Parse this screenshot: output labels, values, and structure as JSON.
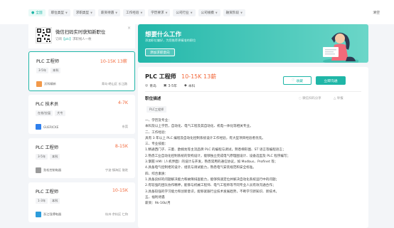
{
  "filters": {
    "chips": [
      {
        "label": "全国",
        "active": true
      },
      {
        "label": "职位类型",
        "active": false
      },
      {
        "label": "求职类型",
        "active": false
      },
      {
        "label": "薪资待遇",
        "active": false
      },
      {
        "label": "工作经验",
        "active": false
      },
      {
        "label": "学历要求",
        "active": false
      },
      {
        "label": "公司行业",
        "active": false
      },
      {
        "label": "公司规模",
        "active": false
      },
      {
        "label": "融资阶段",
        "active": false
      }
    ],
    "clear_label": "清空"
  },
  "qr_promo": {
    "title": "微信扫码实时获知新职位",
    "sub_prefix": "订阅",
    "sub_keyword": "【plc】",
    "sub_suffix": "求职线人一枚"
  },
  "jobs": [
    {
      "title": "PLC 工程师",
      "salary": "10-15K 13薪",
      "tags": [
        "3-5年",
        "本科"
      ],
      "company": "沃科精新",
      "location": "青岛·崂山区 长江路",
      "logo_color": "#f2994a"
    },
    {
      "title": "PLC 技术员",
      "salary": "4-7K",
      "tags": [
        "在校/应届",
        "大专"
      ],
      "company": "GUERICKE",
      "location": "东莞",
      "logo_color": "#2f80ed"
    },
    {
      "title": "PLC 工程师",
      "salary": "8-15K",
      "tags": [
        "3-5年",
        "本科"
      ],
      "company": "劲松控制电器",
      "location": "宁波·镇海区 骆驼",
      "logo_color": "#9b9b9b"
    },
    {
      "title": "PLC 工程师",
      "salary": "10-15K",
      "tags": [
        "1-3年",
        "本科"
      ],
      "company": "浙江强博电器",
      "location": "杭州·余杭区 仁和",
      "logo_color": "#2d9cdb"
    }
  ],
  "banner": {
    "title": "想要什么工作",
    "subtitle": "添加职位偏好，为您推荐更精准的职位",
    "button": "添加求职意向"
  },
  "detail": {
    "title": "PLC 工程师",
    "salary": "10-15K 13薪",
    "city": "青岛",
    "experience": "3-5年",
    "education": "本科",
    "fav_label": "收藏",
    "apply_label": "立即沟通",
    "section_title": "职位描述",
    "share_label": "微信扫码分享",
    "report_label": "举报",
    "skill_tag": "PLC工程师",
    "lines": [
      "一、学历及专业：",
      "本科及以上学历，自动化、电气工程及其自动化、机电一体化等相关专业。",
      "二、工作经验：",
      "具有 3 年以上 PLC 编程及自动化控制系统设计工作经验，有大型项目经验者优先。",
      "三、专业技能：",
      "1.精通西门子、三菱、欧姆龙等主流品牌 PLC 的编程与调试，熟悉梯形图、ST 语言等编程语言；",
      "2.熟悉工业自动化控制系统的架构设计，能够独立完成电气原理图设计、设备选型及 PLC 程序编写；",
      "3.掌握 HMI（人机界面）的设计与开发，熟悉常用的通信协议，如 Modbus、Profinet 等；",
      "4.具备电气控制柜的设计、组装与调试能力，熟悉电气安装规范和安全标准。",
      "四、综合素质：",
      "1.具备良好的问题解决能力和故障排查能力，能够快速定位并解决自动化系统运行中的问题；",
      "2.有较强的团队协作精神，能够与机械工程师、电气工程师等不同专业人员有效沟通合作；",
      "3.具备较强的学习能力和创新意识，能够紧跟行业技术发展趋势，不断学习新知识、新技术。",
      "五、福利待遇",
      "薪资：9k-16k/月"
    ]
  }
}
